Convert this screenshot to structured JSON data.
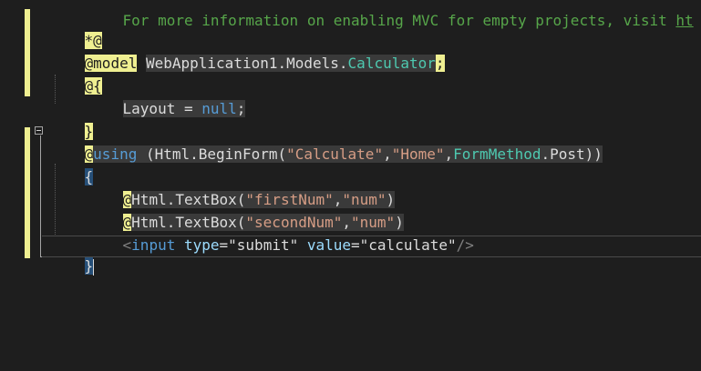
{
  "editor": {
    "lines": {
      "comment_line": {
        "text": "For more information on enabling MVC for empty projects, visit ",
        "link": "ht"
      },
      "comment_close": "*@",
      "model_line": {
        "directive": "@",
        "keyword": "model",
        "namespace": "WebApplication1.Models.",
        "type": "Calculator",
        "semicolon": ";"
      },
      "code_block_open": "@{",
      "layout_line": {
        "name": "Layout",
        "equals": " = ",
        "value": "null",
        "semicolon": ";"
      },
      "code_block_close": "}",
      "using_line": {
        "directive": "@",
        "keyword": "using",
        "open": " (Html.BeginForm(",
        "arg1": "\"Calculate\"",
        "comma1": ",",
        "arg2": "\"Home\"",
        "comma2": ",",
        "enum_type": "FormMethod",
        "enum_member": ".Post",
        "close": "))"
      },
      "block_open": "{",
      "textbox1": {
        "directive": "@",
        "call": "Html.TextBox(",
        "arg1": "\"firstNum\"",
        "comma": ",",
        "arg2": "\"num\"",
        "close": ")"
      },
      "textbox2": {
        "directive": "@",
        "call": "Html.TextBox(",
        "arg1": "\"secondNum\"",
        "comma": ",",
        "arg2": "\"num\"",
        "close": ")"
      },
      "input_line": {
        "lt": "<",
        "tag": "input",
        "attr1": " type",
        "eq1": "=",
        "val1": "\"submit\"",
        "attr2": " value",
        "eq2": "=",
        "val2": "\"calculate\"",
        "end": "/>"
      },
      "block_close": "}"
    }
  }
}
